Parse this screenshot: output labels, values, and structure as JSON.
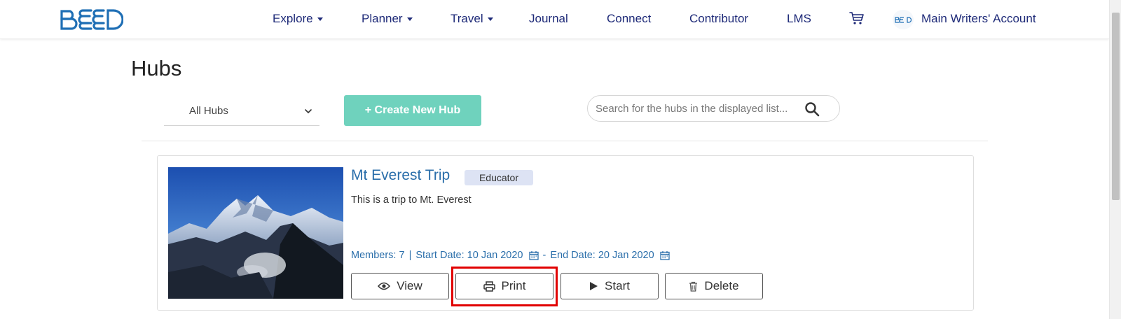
{
  "colors": {
    "nav_text": "#1e2a78",
    "link_blue": "#2a6eaa",
    "create_button_bg": "#6fd2bd",
    "badge_bg": "#dde3f4",
    "highlight": "#e10000"
  },
  "header": {
    "logo_text": "BEED",
    "nav": [
      {
        "label": "Explore",
        "dropdown": true
      },
      {
        "label": "Planner",
        "dropdown": true
      },
      {
        "label": "Travel",
        "dropdown": true
      },
      {
        "label": "Journal",
        "dropdown": false
      },
      {
        "label": "Connect",
        "dropdown": false
      },
      {
        "label": "Contributor",
        "dropdown": false
      },
      {
        "label": "LMS",
        "dropdown": false
      }
    ],
    "cart_icon": "cart-icon",
    "account_name": "Main Writers' Account"
  },
  "main": {
    "title": "Hubs",
    "filter": {
      "selected": "All Hubs"
    },
    "create_button_label": "+ Create New Hub",
    "search": {
      "placeholder": "Search for the hubs in the displayed list...",
      "value": ""
    }
  },
  "hubs": [
    {
      "title": "Mt Everest Trip",
      "badge": "Educator",
      "description": "This is a trip to Mt. Everest",
      "members_label": "Members: 7",
      "start_label": "Start Date: 10 Jan 2020",
      "end_label": "End Date: 20 Jan 2020",
      "separator": "|",
      "dash": "-",
      "actions": {
        "view": "View",
        "print": "Print",
        "start": "Start",
        "delete": "Delete"
      }
    }
  ]
}
